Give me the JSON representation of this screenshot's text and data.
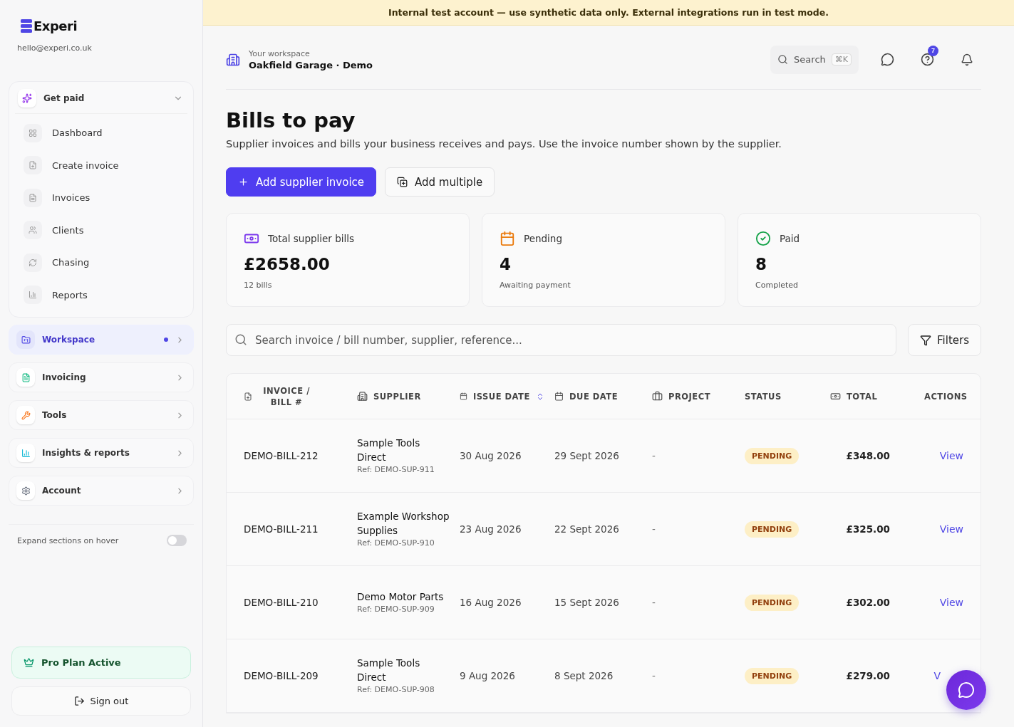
{
  "banner": {
    "text": "Internal test account — use synthetic data only. External integrations run in test mode."
  },
  "sidebar": {
    "brand": "Experi",
    "email": "hello@experi.co.uk",
    "group": {
      "label": "Get paid",
      "expanded": true,
      "items": [
        {
          "label": "Dashboard",
          "selected": false
        },
        {
          "label": "Create invoice",
          "selected": false
        },
        {
          "label": "Invoices",
          "selected": false
        },
        {
          "label": "Clients",
          "selected": false
        },
        {
          "label": "Chasing",
          "selected": false
        },
        {
          "label": "Reports",
          "selected": false
        }
      ]
    },
    "sections": [
      {
        "label": "Workspace",
        "selected": true,
        "dot": true
      },
      {
        "label": "Invoicing",
        "selected": false,
        "dot": false
      },
      {
        "label": "Tools",
        "selected": false,
        "dot": false
      },
      {
        "label": "Insights & reports",
        "selected": false,
        "dot": false
      },
      {
        "label": "Account",
        "selected": false,
        "dot": false
      }
    ],
    "hover_toggle": {
      "label": "Expand sections on hover",
      "on": false
    },
    "plan": "Pro Plan Active",
    "sign_out": "Sign out"
  },
  "header": {
    "workspace_label": "Your workspace",
    "workspace_name": "Oakfield Garage · Demo",
    "search": {
      "placeholder": "Search",
      "shortcut": "⌘K"
    },
    "help_badge": "7"
  },
  "page": {
    "title": "Bills to pay",
    "description": "Supplier invoices and bills your business receives and pays. Use the invoice number shown by the supplier.",
    "primary_button": "Add supplier invoice",
    "secondary_button": "Add multiple"
  },
  "stats": [
    {
      "label": "Total supplier bills",
      "value": "£2658.00",
      "note": "12 bills"
    },
    {
      "label": "Pending",
      "value": "4",
      "note": "Awaiting payment"
    },
    {
      "label": "Paid",
      "value": "8",
      "note": "Completed"
    }
  ],
  "table_search": {
    "placeholder": "Search invoice / bill number, supplier, reference..."
  },
  "filters_button": "Filters",
  "table": {
    "columns": [
      {
        "label": "INVOICE / BILL #",
        "sortable": false
      },
      {
        "label": "SUPPLIER",
        "sortable": false
      },
      {
        "label": "ISSUE DATE",
        "sortable": true
      },
      {
        "label": "DUE DATE",
        "sortable": false
      },
      {
        "label": "PROJECT",
        "sortable": false
      },
      {
        "label": "STATUS",
        "sortable": false
      },
      {
        "label": "TOTAL",
        "sortable": false
      },
      {
        "label": "ACTIONS",
        "sortable": false
      }
    ],
    "rows": [
      {
        "number": "DEMO-BILL-212",
        "supplier": "Sample Tools Direct",
        "ref": "Ref: DEMO-SUP-911",
        "issue": "30 Aug 2026",
        "due": "29 Sept 2026",
        "project": "-",
        "status": "PENDING",
        "total": "£348.00",
        "action": "View"
      },
      {
        "number": "DEMO-BILL-211",
        "supplier": "Example Workshop Supplies",
        "ref": "Ref: DEMO-SUP-910",
        "issue": "23 Aug 2026",
        "due": "22 Sept 2026",
        "project": "-",
        "status": "PENDING",
        "total": "£325.00",
        "action": "View"
      },
      {
        "number": "DEMO-BILL-210",
        "supplier": "Demo Motor Parts",
        "ref": "Ref: DEMO-SUP-909",
        "issue": "16 Aug 2026",
        "due": "15 Sept 2026",
        "project": "-",
        "status": "PENDING",
        "total": "£302.00",
        "action": "View"
      },
      {
        "number": "DEMO-BILL-209",
        "supplier": "Sample Tools Direct",
        "ref": "Ref: DEMO-SUP-908",
        "issue": "9 Aug 2026",
        "due": "8 Sept 2026",
        "project": "-",
        "status": "PENDING",
        "total": "£279.00",
        "action": "V"
      }
    ]
  }
}
